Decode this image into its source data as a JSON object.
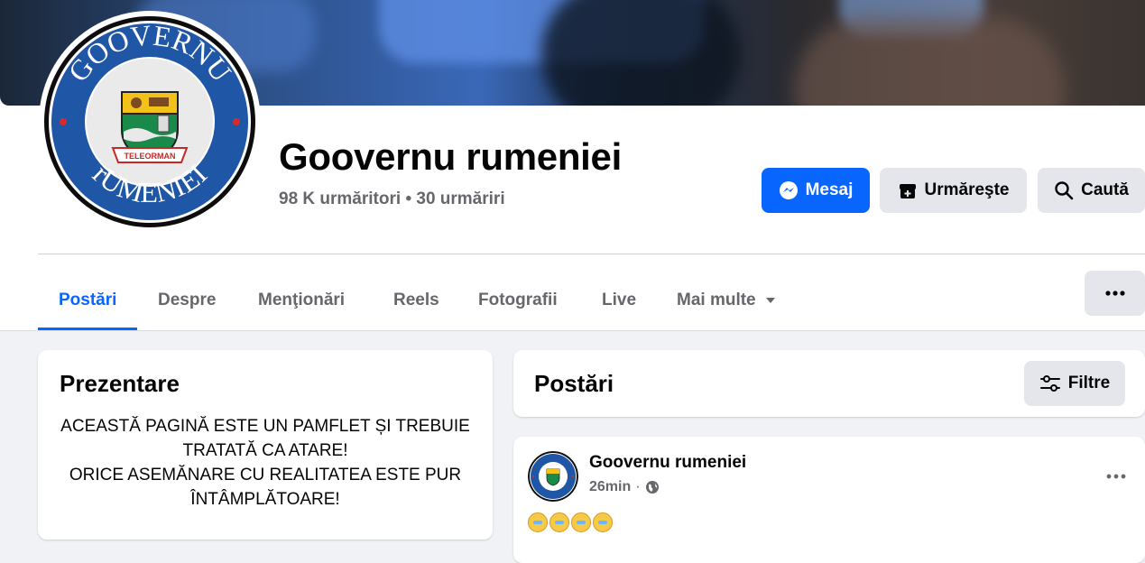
{
  "profile": {
    "name": "Goovernu rumeniei",
    "followers": "98 K urmăritori",
    "separator": "•",
    "following": "30 urmăriri",
    "logo": {
      "top_text": "GOOVERNU",
      "bottom_text": "rUMENIEI",
      "banner_text": "TELEORMAN"
    }
  },
  "actions": {
    "message_label": "Mesaj",
    "follow_label": "Urmăreşte",
    "search_label": "Caută"
  },
  "tabs": [
    {
      "label": "Postări",
      "active": true
    },
    {
      "label": "Despre"
    },
    {
      "label": "Menţionări"
    },
    {
      "label": "Reels"
    },
    {
      "label": "Fotografii"
    },
    {
      "label": "Live"
    },
    {
      "label": "Mai multe"
    }
  ],
  "intro": {
    "title": "Prezentare",
    "text_line1": "ACEASTĂ PAGINĂ ESTE UN PAMFLET ȘI TREBUIE TRATATĂ CA ATARE!",
    "text_line2": "ORICE ASEMĂNARE CU REALITATEA ESTE PUR ÎNTÂMPLĂTOARE!"
  },
  "posts": {
    "title": "Postări",
    "filter_label": "Filtre",
    "items": [
      {
        "author": "Goovernu rumeniei",
        "time": "26min",
        "separator": "·",
        "audience_icon": "globe-icon"
      }
    ]
  },
  "colors": {
    "accent": "#0866ff",
    "button_gray": "#e4e6eb",
    "page_bg": "#f0f2f5",
    "logo_blue": "#1f56a6"
  }
}
